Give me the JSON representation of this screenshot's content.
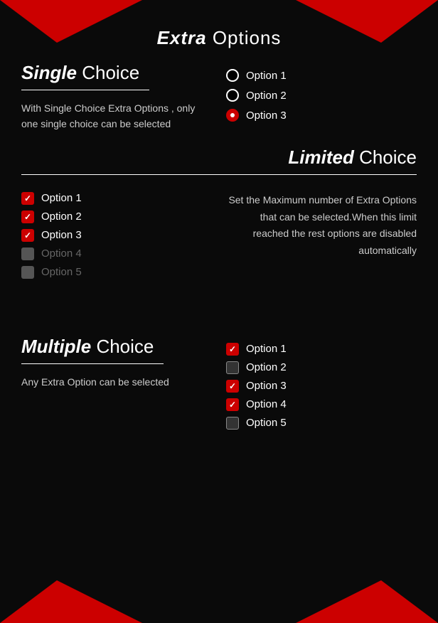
{
  "page": {
    "title_bold": "Extra",
    "title_normal": " Options"
  },
  "single_choice": {
    "heading_bold": "Single",
    "heading_normal": " Choice",
    "description": "With Single Choice Extra Options ,  only one single choice can be selected",
    "options": [
      {
        "label": "Option 1",
        "selected": false
      },
      {
        "label": "Option 2",
        "selected": false
      },
      {
        "label": "Option 3",
        "selected": true
      }
    ]
  },
  "limited_choice": {
    "heading_bold": "Limited",
    "heading_normal": " Choice",
    "description": "Set the Maximum number of Extra Options that can be selected.When this limit reached the rest options are disabled automatically",
    "options": [
      {
        "label": "Option 1",
        "checked": true,
        "disabled": false
      },
      {
        "label": "Option 2",
        "checked": true,
        "disabled": false
      },
      {
        "label": "Option 3",
        "checked": true,
        "disabled": false
      },
      {
        "label": "Option 4",
        "checked": false,
        "disabled": true
      },
      {
        "label": "Option 5",
        "checked": false,
        "disabled": true
      }
    ]
  },
  "multiple_choice": {
    "heading_bold": "Multiple",
    "heading_normal": " Choice",
    "description": "Any Extra Option can be selected",
    "options": [
      {
        "label": "Option 1",
        "checked": true,
        "disabled": false
      },
      {
        "label": "Option 2",
        "checked": false,
        "disabled": false
      },
      {
        "label": "Option 3",
        "checked": true,
        "disabled": false
      },
      {
        "label": "Option 4",
        "checked": true,
        "disabled": false
      },
      {
        "label": "Option 5",
        "checked": false,
        "disabled": false
      }
    ]
  }
}
